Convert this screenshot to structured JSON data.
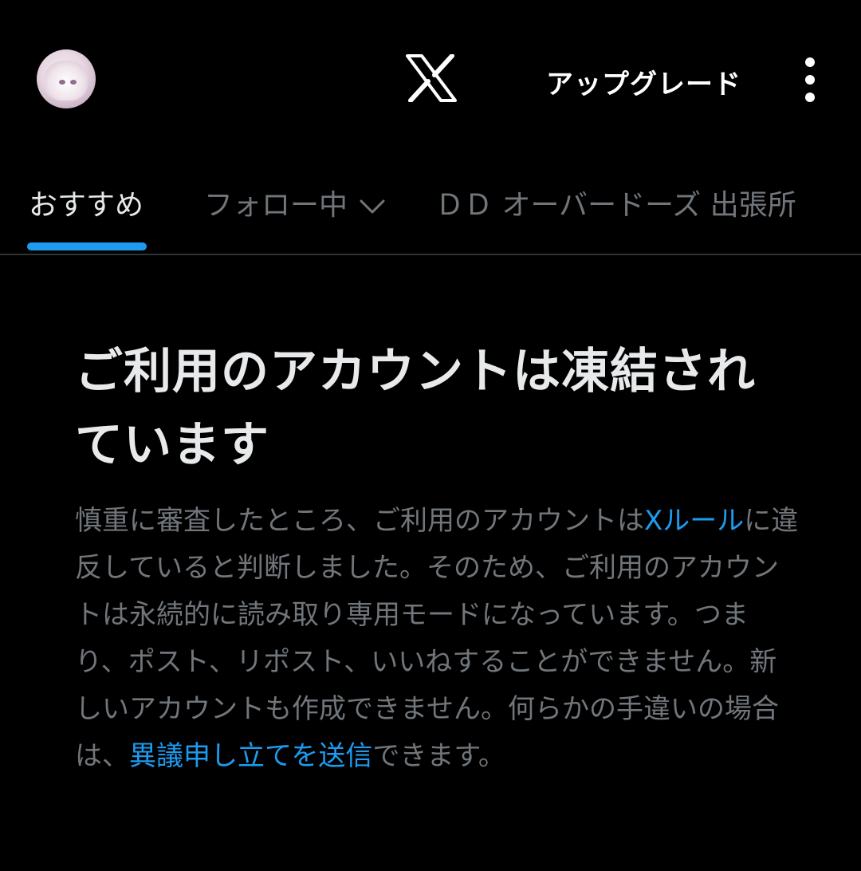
{
  "header": {
    "upgrade_label": "アップグレード",
    "logo_icon": "x-logo-icon",
    "more_icon": "vertical-ellipsis-icon"
  },
  "tabs": [
    {
      "label": "おすすめ",
      "active": true
    },
    {
      "label": "フォロー中",
      "active": false
    },
    {
      "label": "ＤＤ オーバードーズ 出張所",
      "active": false
    }
  ],
  "notice": {
    "title": "ご利用のアカウントは凍結されています",
    "body_1": "慎重に審査したところ、ご利用のアカウントは",
    "rules_link": "Xルール",
    "body_2": "に違反していると判断しました。そのため、ご利用のアカウントは永続的に読み取り専用モードになっています。つまり、ポスト、リポスト、いいねすることができません。新しいアカウントも作成できません。何らかの手違いの場合は、",
    "appeal_link": "異議申し立てを送信",
    "body_3": "できます。"
  },
  "colors": {
    "accent": "#1d9bf0",
    "background": "#000000",
    "primary_text": "#e7e9ea",
    "secondary_text": "#71767b"
  }
}
